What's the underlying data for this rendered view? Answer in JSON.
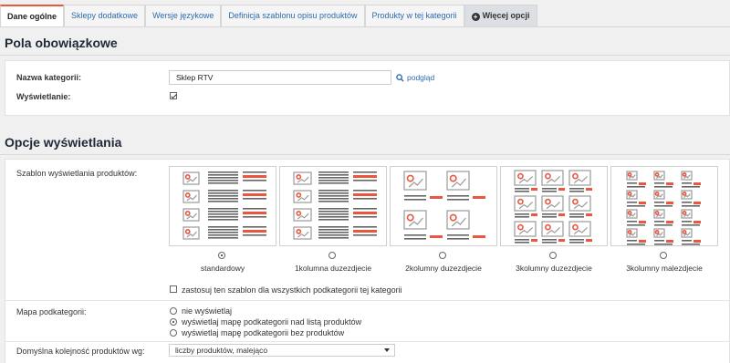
{
  "tabs": [
    {
      "label": "Dane ogólne"
    },
    {
      "label": "Sklepy dodatkowe"
    },
    {
      "label": "Wersje językowe"
    },
    {
      "label": "Definicja szablonu opisu produktów"
    },
    {
      "label": "Produkty w tej kategorii"
    },
    {
      "label": "Więcej opcji"
    }
  ],
  "required": {
    "title": "Pola obowiązkowe",
    "name_label": "Nazwa kategorii:",
    "name_value": "Sklep RTV",
    "preview_link": "podgląd",
    "visibility_label": "Wyświetlanie:",
    "visibility_checked": true
  },
  "display": {
    "title": "Opcje wyświetlania",
    "template_label": "Szablon wyświetlania produktów:",
    "templates": [
      {
        "name": "standardowy",
        "selected": true
      },
      {
        "name": "1kolumna duzezdjecie",
        "selected": false
      },
      {
        "name": "2kolumny duzezdjecie",
        "selected": false
      },
      {
        "name": "3kolumny duzezdjecie",
        "selected": false
      },
      {
        "name": "3kolumny malezdjecie",
        "selected": false
      }
    ],
    "apply_all_label": "zastosuj ten szablon dla wszystkich podkategorii tej kategorii",
    "apply_all_checked": false,
    "submap_label": "Mapa podkategorii:",
    "submap_options": [
      {
        "label": "nie wyświetlaj",
        "selected": false
      },
      {
        "label": "wyświetlaj mapę podkategorii nad listą produktów",
        "selected": true
      },
      {
        "label": "wyświetlaj mapę podkategorii bez produktów",
        "selected": false
      }
    ],
    "sort_label": "Domyślna kolejność produktów wg:",
    "sort_value": "liczby produktów, malejąco"
  },
  "colors": {
    "accent": "#e9573f",
    "link": "#2b6cb0",
    "icon_gray": "#9a9a9a"
  },
  "icons": [
    "plus-circle-icon",
    "search-icon",
    "image-placeholder-icon",
    "chevron-down-icon"
  ]
}
